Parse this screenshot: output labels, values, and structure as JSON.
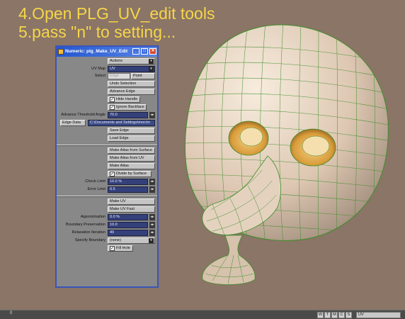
{
  "captions": {
    "line1": "4.Open PLG_UV_edit tools",
    "line2": "5.pass \"n\" to setting..."
  },
  "window": {
    "title": "Numeric: plg_Make_UV_Edit",
    "actions": "Actions",
    "uv_map_label": "UV Map",
    "uv_map_value": "UV",
    "select_label": "Select",
    "select_edge": "Edge",
    "select_point": "Point",
    "undo_selection": "Undo Selection",
    "advance_edge": "Advance Edge",
    "hide_handle": "Hide Handle",
    "ignore_backface": "Ignore Backface",
    "threshold_label": "Advance Threshold Angle",
    "threshold_value": "70.0",
    "edge_data": "Edge Data",
    "edge_path": "C:\\Documents and Settings\\moc\\m",
    "save_edge": "Save Edge",
    "load_edge": "Load Edge",
    "atlas_from_surface": "Make Atlas from Surface",
    "atlas_from_uv": "Make Atlas from UV",
    "make_atlas": "Make Atlas",
    "divide_by_surface": "Divide by Surface",
    "check_limit_label": "Check Limit",
    "check_limit_value": "10.0 %",
    "error_limit_label": "Error Limit",
    "error_limit_value": "0.5",
    "make_uv": "Make UV",
    "make_uv_fast": "Make UV Fast",
    "approx_label": "Approximation",
    "approx_value": "0.0 %",
    "boundary_label": "Boundary Preservation",
    "boundary_value": "10.0",
    "relax_label": "Relaxation Iteration",
    "relax_value": "40",
    "specify_boundary_label": "Specify Boundary",
    "specify_boundary_value": "(none)",
    "fill_hole": "Fill Hole"
  },
  "statusbar": {
    "frame": "0",
    "buttons": [
      "W",
      "T",
      "M",
      "C",
      "S"
    ],
    "uv_dropdown": "UV"
  },
  "colors": {
    "caption": "#f6d54a",
    "background": "#8a7566",
    "titlebar": "#2456d0",
    "field": "#34407a"
  }
}
